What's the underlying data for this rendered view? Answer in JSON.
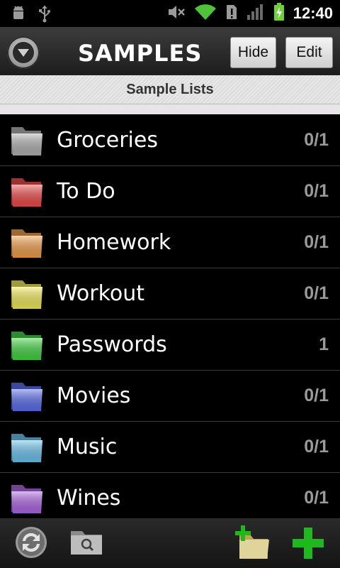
{
  "status_bar": {
    "icons": [
      "android-debug-icon",
      "usb-icon",
      "mute-icon",
      "wifi-icon",
      "alert-icon",
      "signal-icon",
      "battery-charging-icon"
    ],
    "time": "12:40"
  },
  "header": {
    "title": "SAMPLES",
    "hide_label": "Hide",
    "edit_label": "Edit"
  },
  "section": {
    "title": "Sample Lists"
  },
  "lists": [
    {
      "name": "Groceries",
      "count": "0/1",
      "color": "#b4b4b4"
    },
    {
      "name": "To Do",
      "count": "0/1",
      "color": "#f24a4a"
    },
    {
      "name": "Homework",
      "count": "0/1",
      "color": "#f6a04a"
    },
    {
      "name": "Workout",
      "count": "0/1",
      "color": "#f5ef5a"
    },
    {
      "name": "Passwords",
      "count": "1",
      "color": "#42d742"
    },
    {
      "name": "Movies",
      "count": "0/1",
      "color": "#5a6ef0"
    },
    {
      "name": "Music",
      "count": "0/1",
      "color": "#6cc6f2"
    },
    {
      "name": "Wines",
      "count": "0/1",
      "color": "#b067e6"
    }
  ],
  "bottom_bar": {
    "icons": [
      "sync-icon",
      "search-folder-icon",
      "add-folder-icon",
      "add-item-icon"
    ]
  },
  "colors": {
    "accent_green": "#1fb81f",
    "count_gray": "#9a9a9a"
  }
}
